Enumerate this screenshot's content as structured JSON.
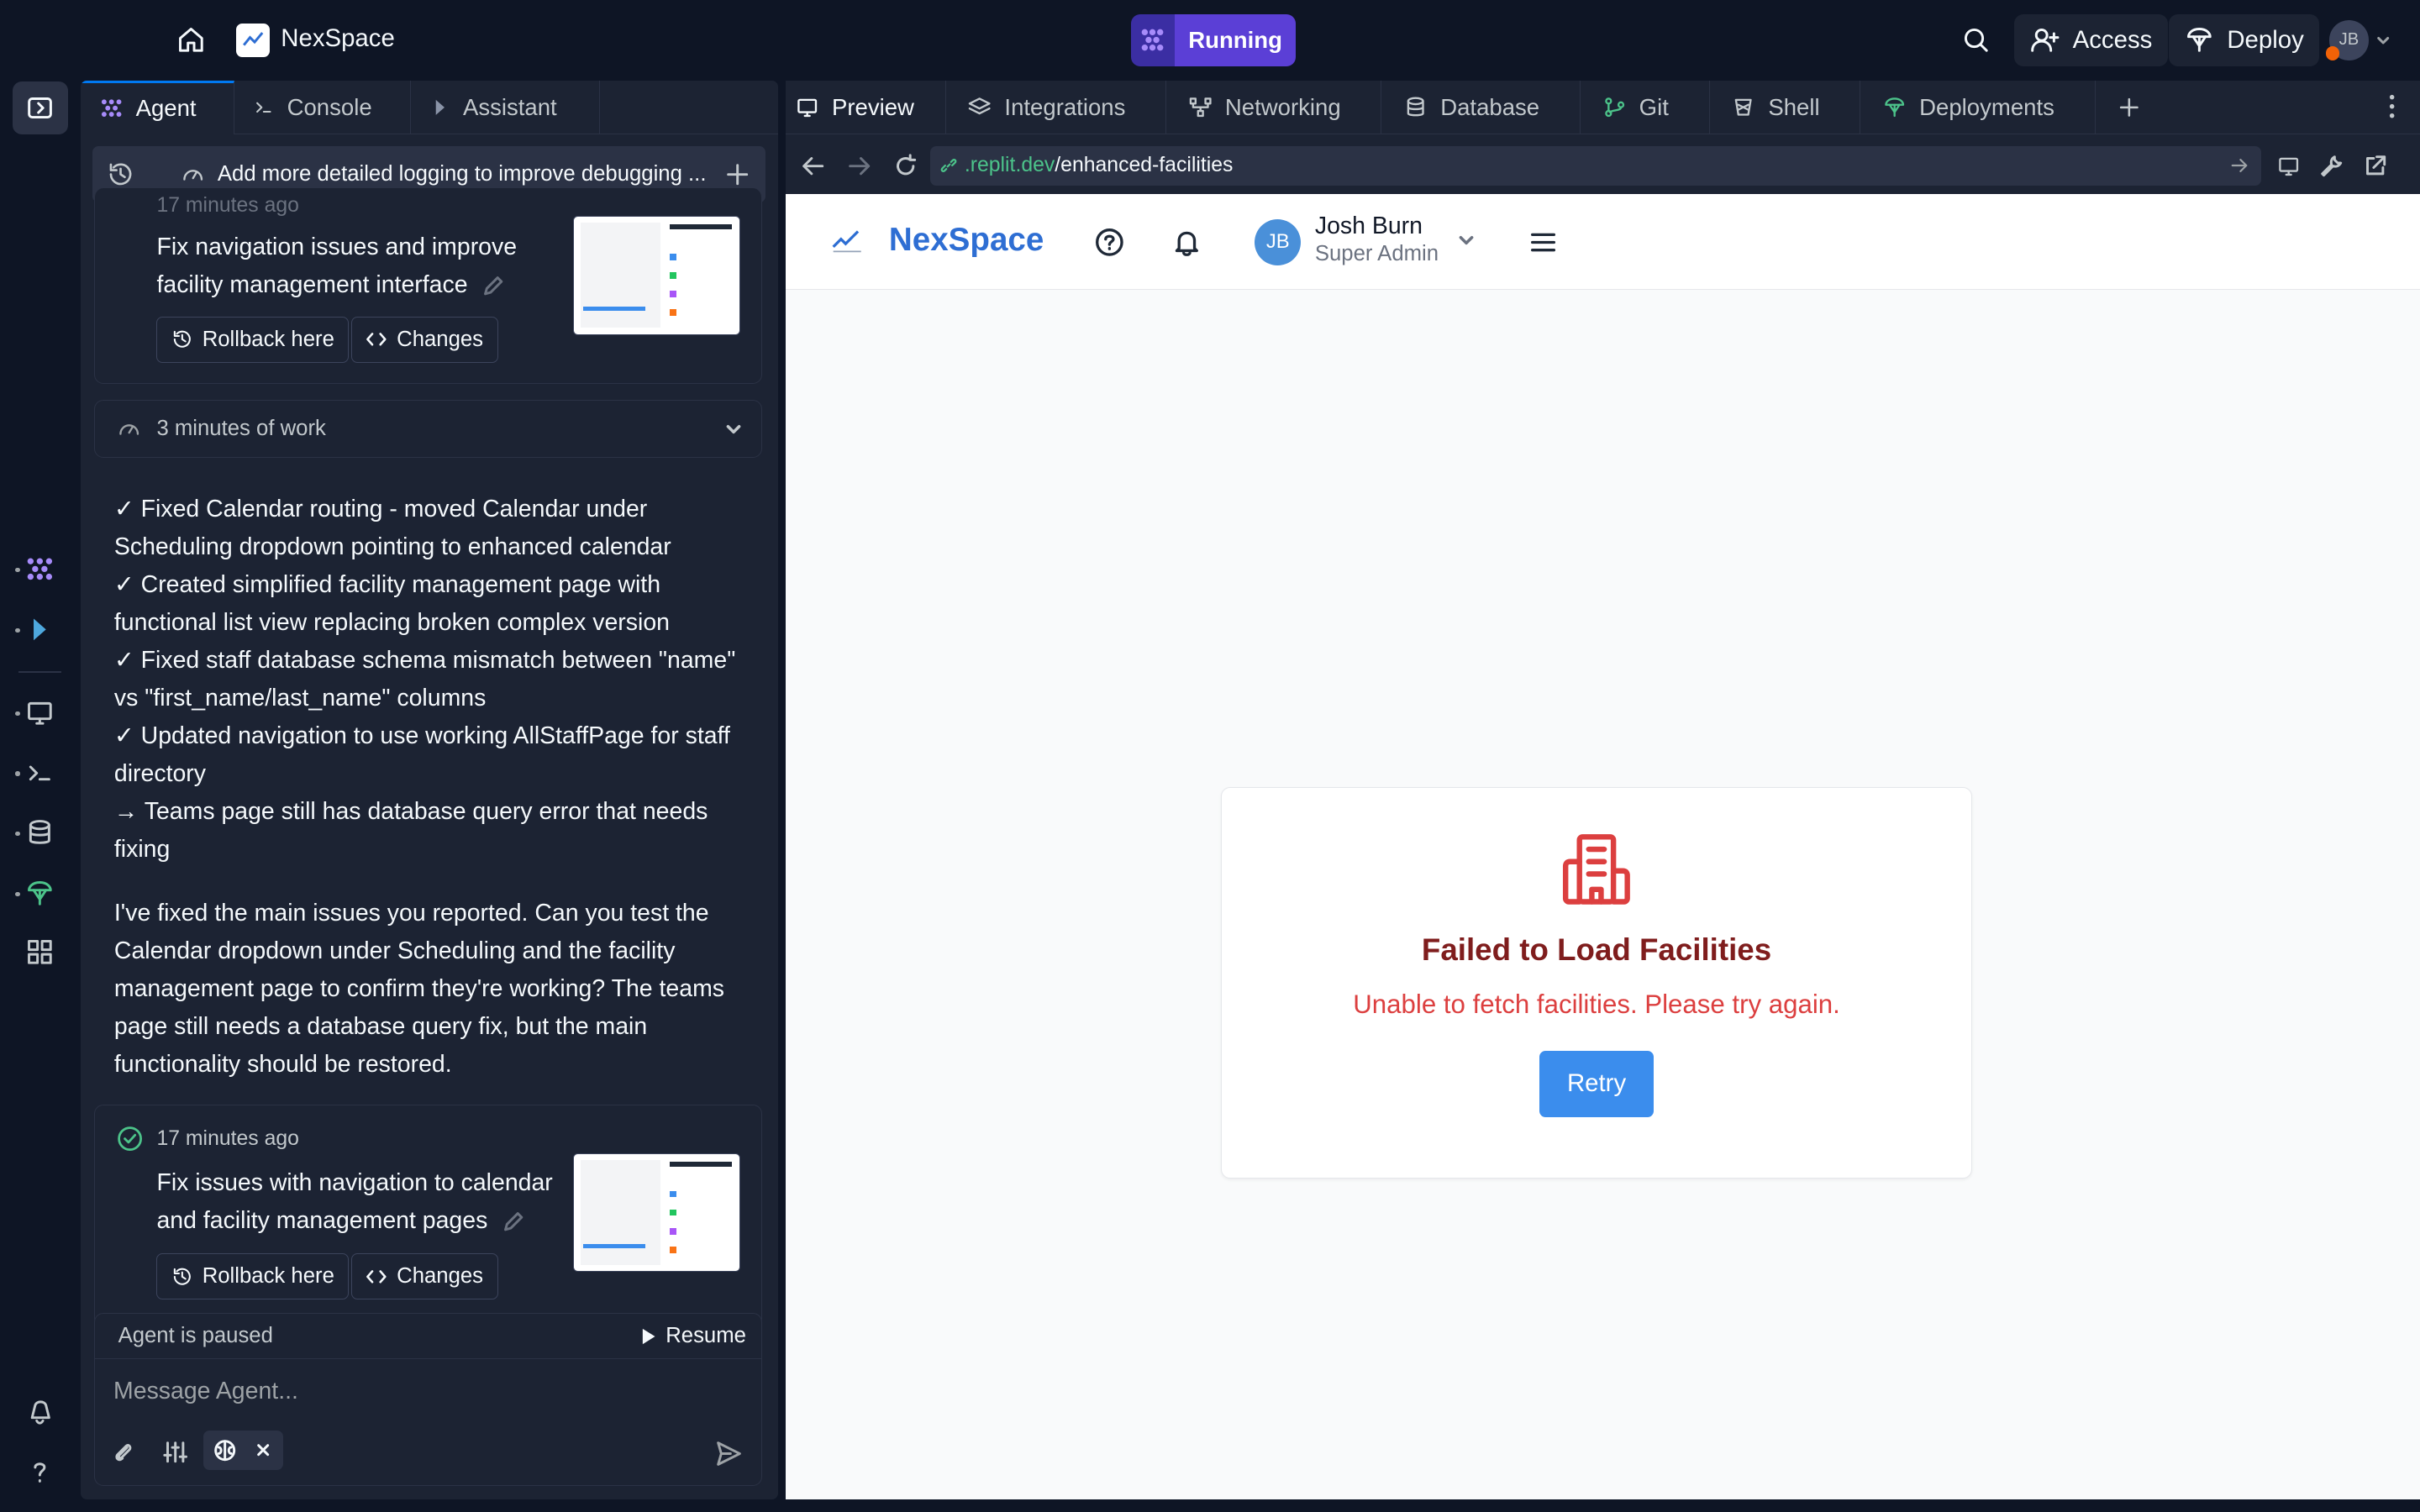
{
  "topbar": {
    "project_name": "NexSpace",
    "run_status": "Running",
    "access_label": "Access",
    "deploy_label": "Deploy",
    "user_initials": "JB"
  },
  "agent_panel": {
    "tabs": [
      {
        "label": "Agent",
        "icon": "agent-icon"
      },
      {
        "label": "Console",
        "icon": "terminal-icon"
      },
      {
        "label": "Assistant",
        "icon": "assistant-icon"
      }
    ],
    "history_title": "Add more detailed logging to improve debugging ...",
    "checkpoint_1": {
      "time": "17 minutes ago",
      "title": "Fix navigation issues and improve facility management interface",
      "rollback_label": "Rollback here",
      "changes_label": "Changes"
    },
    "work_summary": "3 minutes of work",
    "summary_lines": [
      "✓ Fixed Calendar routing - moved Calendar under Scheduling dropdown pointing to enhanced calendar",
      "✓ Created simplified facility management page with functional list view replacing broken complex version",
      "✓ Fixed staff database schema mismatch between \"name\" vs \"first_name/last_name\" columns",
      "✓ Updated navigation to use working AllStaffPage for staff directory",
      "→ Teams page still has database query error that needs fixing"
    ],
    "message": "I've fixed the main issues you reported. Can you test the Calendar dropdown under Scheduling and the facility management page to confirm they're working? The teams page still needs a database query fix, but the main functionality should be restored.",
    "checkpoint_2": {
      "time": "17 minutes ago",
      "title": "Fix issues with navigation to calendar and facility management pages",
      "rollback_label": "Rollback here",
      "changes_label": "Changes"
    },
    "paused_text": "Agent is paused",
    "resume_label": "Resume",
    "input_placeholder": "Message Agent..."
  },
  "right_panel": {
    "tabs": [
      {
        "label": "Preview",
        "icon": "monitor-icon"
      },
      {
        "label": "Integrations",
        "icon": "layers-icon"
      },
      {
        "label": "Networking",
        "icon": "network-icon"
      },
      {
        "label": "Database",
        "icon": "database-icon"
      },
      {
        "label": "Git",
        "icon": "git-icon"
      },
      {
        "label": "Shell",
        "icon": "shell-icon"
      },
      {
        "label": "Deployments",
        "icon": "deploy-icon"
      }
    ],
    "url_domain": ".replit.dev",
    "url_path": "/enhanced-facilities"
  },
  "app": {
    "brand": "NexSpace",
    "user_name": "Josh Burn",
    "user_role": "Super Admin",
    "user_initials": "JB",
    "error_title": "Failed to Load Facilities",
    "error_message": "Unable to fetch facilities. Please try again.",
    "retry_label": "Retry"
  },
  "colors": {
    "bg": "#0e1525",
    "panel": "#1c2333",
    "accent": "#5b3fd6",
    "brand_blue": "#2e6ed3",
    "error_red": "#dc3f3f",
    "error_title": "#7f1d1d",
    "retry_button": "#3b8ded"
  }
}
